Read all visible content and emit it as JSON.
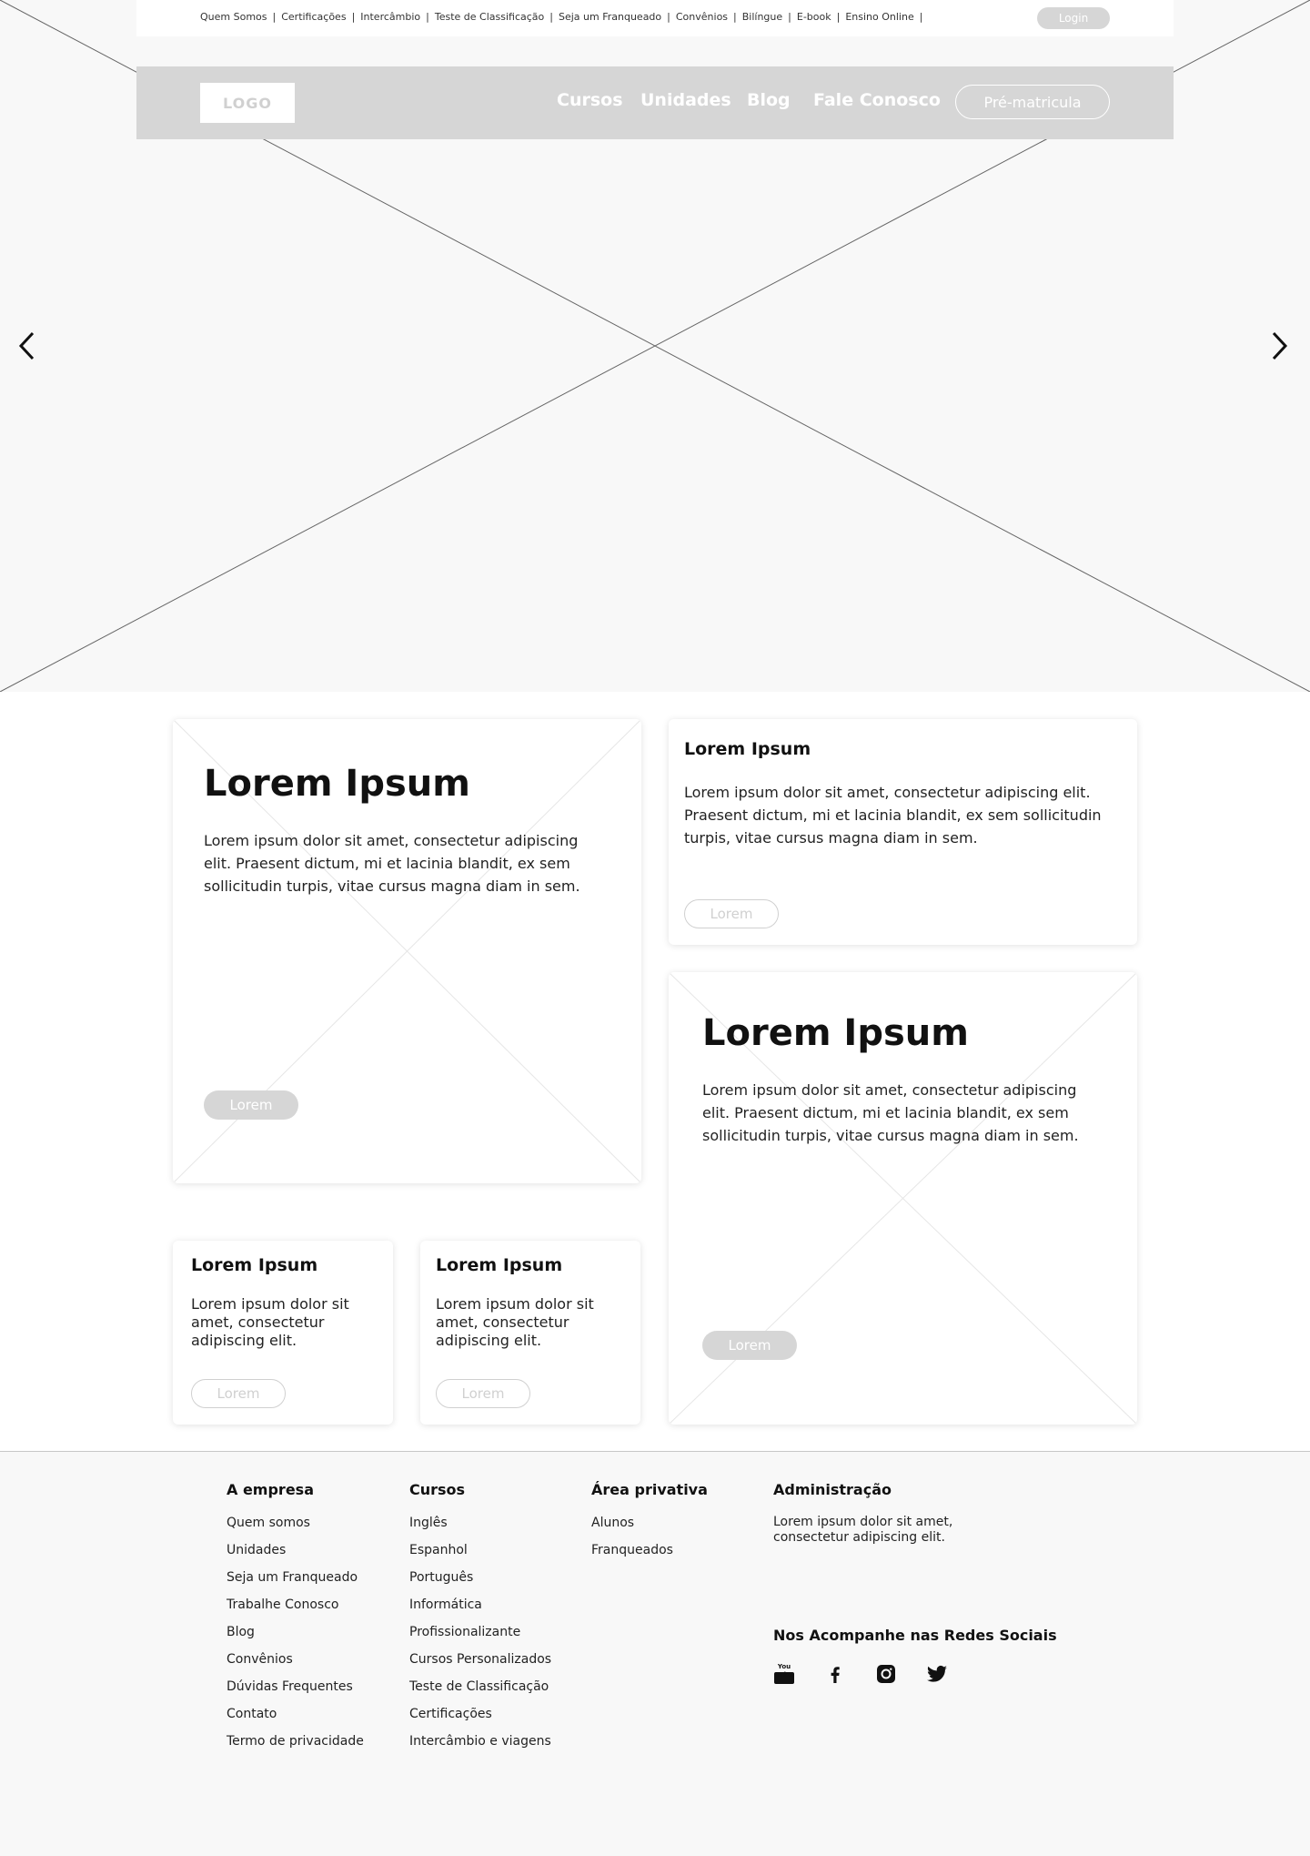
{
  "topbar": {
    "links": [
      "Quem Somos",
      "Certificações",
      "Intercâmbio",
      "Teste de Classificação",
      "Seja um Franqueado",
      "Convênios",
      "Bilíngue",
      "E-book",
      "Ensino Online"
    ],
    "login": "Login"
  },
  "nav": {
    "logo": "LOGO",
    "cursos": "Cursos",
    "unidades": "Unidades",
    "blog": "Blog",
    "fale": "Fale Conosco",
    "prematricula": "Pré-matricula"
  },
  "cards": {
    "big1": {
      "title": "Lorem Ipsum",
      "text": "Lorem ipsum dolor sit amet, consectetur adipiscing elit. Praesent dictum, mi et lacinia blandit, ex sem sollicitudin turpis, vitae cursus magna diam in sem.",
      "button": "Lorem"
    },
    "top_right": {
      "title": "Lorem Ipsum",
      "text": "Lorem ipsum dolor sit amet, consectetur adipiscing elit. Praesent dictum, mi et lacinia blandit, ex sem sollicitudin turpis, vitae cursus magna diam in sem.",
      "button": "Lorem"
    },
    "big2": {
      "title": "Lorem Ipsum",
      "text": "Lorem ipsum dolor sit amet, consectetur adipiscing elit. Praesent dictum, mi et lacinia blandit, ex sem sollicitudin turpis, vitae cursus magna diam in sem.",
      "button": "Lorem"
    },
    "small1": {
      "title": "Lorem Ipsum",
      "text": "Lorem ipsum dolor sit amet, consectetur adipiscing elit.",
      "button": "Lorem"
    },
    "small2": {
      "title": "Lorem Ipsum",
      "text": "Lorem ipsum dolor sit amet, consectetur adipiscing elit.",
      "button": "Lorem"
    }
  },
  "footer": {
    "empresa": {
      "heading": "A empresa",
      "items": [
        "Quem somos",
        "Unidades",
        "Seja um Franqueado",
        "Trabalhe Conosco",
        "Blog",
        "Convênios",
        "Dúvidas Frequentes",
        "Contato",
        "Termo de privacidade"
      ]
    },
    "cursos": {
      "heading": "Cursos",
      "items": [
        "Inglês",
        "Espanhol",
        "Português",
        "Informática",
        "Profissionalizante",
        "Cursos Personalizados",
        "Teste de Classificação",
        "Certificações",
        "Intercâmbio e viagens"
      ]
    },
    "privativa": {
      "heading": "Área privativa",
      "items": [
        "Alunos",
        "Franqueados"
      ]
    },
    "admin": {
      "heading": "Administração",
      "text": "Lorem ipsum dolor sit amet, consectetur adipiscing elit."
    },
    "social": {
      "heading": "Nos Acompanhe nas Redes Sociais",
      "icons": [
        "youtube-icon",
        "facebook-icon",
        "instagram-icon",
        "twitter-icon"
      ],
      "youtube_text": "You Tube"
    }
  }
}
